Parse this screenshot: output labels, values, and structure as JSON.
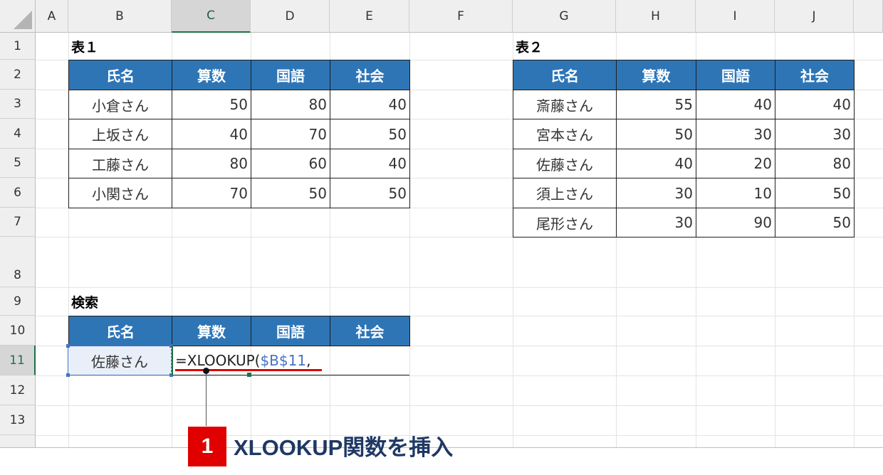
{
  "columns": [
    "A",
    "B",
    "C",
    "D",
    "E",
    "F",
    "G",
    "H",
    "I",
    "J"
  ],
  "rows": [
    "1",
    "2",
    "3",
    "4",
    "5",
    "6",
    "7",
    "8",
    "9",
    "10",
    "11",
    "12",
    "13"
  ],
  "selected_column": "C",
  "selected_row": "11",
  "table1": {
    "title": "表１",
    "headers": [
      "氏名",
      "算数",
      "国語",
      "社会"
    ],
    "rows": [
      [
        "小倉さん",
        "50",
        "80",
        "40"
      ],
      [
        "上坂さん",
        "40",
        "70",
        "50"
      ],
      [
        "工藤さん",
        "80",
        "60",
        "40"
      ],
      [
        "小関さん",
        "70",
        "50",
        "50"
      ]
    ]
  },
  "table2": {
    "title": "表２",
    "headers": [
      "氏名",
      "算数",
      "国語",
      "社会"
    ],
    "rows": [
      [
        "斎藤さん",
        "55",
        "40",
        "40"
      ],
      [
        "宮本さん",
        "50",
        "30",
        "30"
      ],
      [
        "佐藤さん",
        "40",
        "20",
        "80"
      ],
      [
        "須上さん",
        "30",
        "10",
        "50"
      ],
      [
        "尾形さん",
        "30",
        "90",
        "50"
      ]
    ]
  },
  "search": {
    "title": "検索",
    "headers": [
      "氏名",
      "算数",
      "国語",
      "社会"
    ],
    "name_value": "佐藤さん",
    "formula_prefix": "=XLOOKUP(",
    "formula_ref": "$B$11",
    "formula_suffix": ","
  },
  "callout": {
    "number": "1",
    "text": "XLOOKUP関数を挿入",
    "number_color": "#e00000",
    "text_color": "#1f3864"
  },
  "colors": {
    "header_fill": "#2e75b6",
    "selection_green": "#1f7145",
    "reference_blue": "#4472c4",
    "underline_red": "#e00000"
  }
}
